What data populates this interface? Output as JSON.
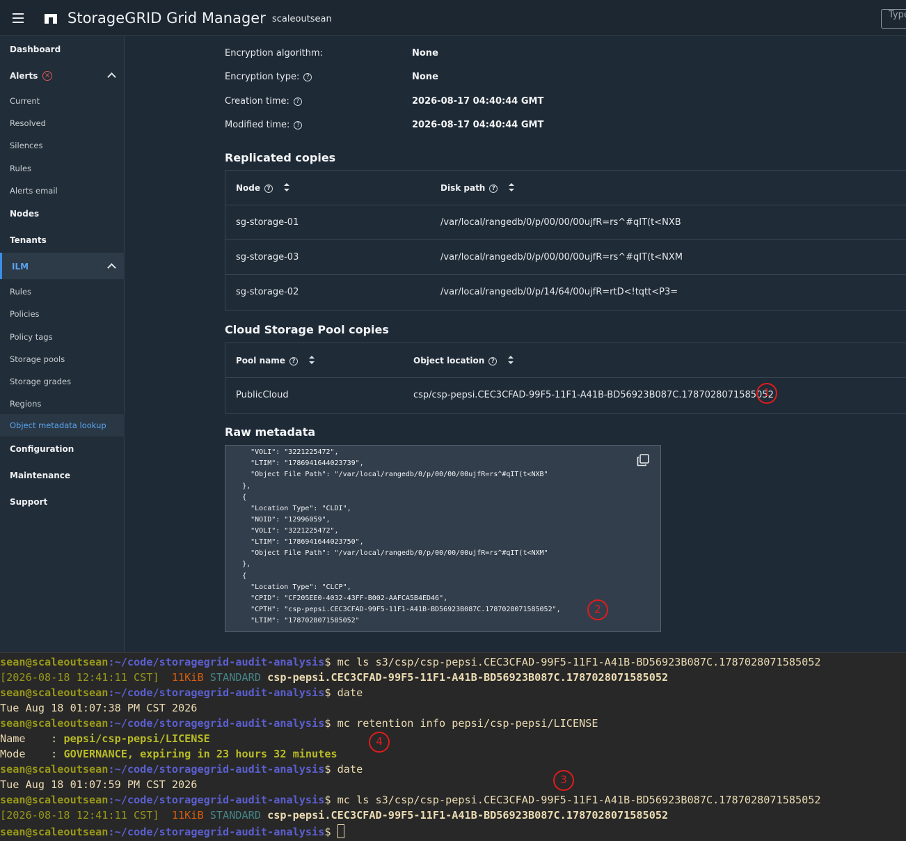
{
  "header": {
    "app_title": "StorageGRID Grid Manager",
    "grid_name": "scaleoutsean",
    "search_placeholder": "Type"
  },
  "sidebar": {
    "dashboard": "Dashboard",
    "alerts": "Alerts",
    "alerts_sub": [
      "Current",
      "Resolved",
      "Silences",
      "Rules",
      "Alerts email"
    ],
    "nodes": "Nodes",
    "tenants": "Tenants",
    "ilm": "ILM",
    "ilm_sub": [
      "Rules",
      "Policies",
      "Policy tags",
      "Storage pools",
      "Storage grades",
      "Regions",
      "Object metadata lookup"
    ],
    "configuration": "Configuration",
    "maintenance": "Maintenance",
    "support": "Support"
  },
  "object_info": {
    "encryption_algorithm_label": "Encryption algorithm:",
    "encryption_algorithm_value": "None",
    "encryption_type_label": "Encryption type:",
    "encryption_type_value": "None",
    "creation_time_label": "Creation time:",
    "creation_time_value": "2026-08-17 04:40:44 GMT",
    "modified_time_label": "Modified time:",
    "modified_time_value": "2026-08-17 04:40:44 GMT"
  },
  "replicated": {
    "title": "Replicated copies",
    "col_node": "Node",
    "col_disk_path": "Disk path",
    "rows": [
      {
        "node": "sg-storage-01",
        "path": "/var/local/rangedb/0/p/00/00/00ujfR=rs^#qIT(t<NXB"
      },
      {
        "node": "sg-storage-03",
        "path": "/var/local/rangedb/0/p/00/00/00ujfR=rs^#qIT(t<NXM"
      },
      {
        "node": "sg-storage-02",
        "path": "/var/local/rangedb/0/p/14/64/00ujfR=rtD<!tqtt<P3="
      }
    ]
  },
  "cloud": {
    "title": "Cloud Storage Pool copies",
    "col_pool": "Pool name",
    "col_location": "Object location",
    "rows": [
      {
        "pool": "PublicCloud",
        "location": "csp/csp-pepsi.CEC3CFAD-99F5-11F1-A41B-BD56923B087C.1787028071585052"
      }
    ]
  },
  "raw": {
    "title": "Raw metadata",
    "lines": [
      "      \"VOLI\": \"3221225472\",",
      "      \"LTIM\": \"1786941644023739\",",
      "      \"Object File Path\": \"/var/local/rangedb/0/p/00/00/00ujfR=rs^#qIT(t<NXB\"",
      "    },",
      "    {",
      "      \"Location Type\": \"CLDI\",",
      "      \"NOID\": \"12996059\",",
      "      \"VOLI\": \"3221225472\",",
      "      \"LTIM\": \"1786941644023750\",",
      "      \"Object File Path\": \"/var/local/rangedb/0/p/00/00/00ujfR=rs^#qIT(t<NXM\"",
      "    },",
      "    {",
      "      \"Location Type\": \"CLCP\",",
      "      \"CPID\": \"CF205EE0-4032-43FF-B002-AAFCA5B4ED46\",",
      "      \"CPTH\": \"csp-pepsi.CEC3CFAD-99F5-11F1-A41B-BD56923B087C.1787028071585052\",",
      "      \"LTIM\": \"1787028071585052\""
    ]
  },
  "annotations": [
    "1",
    "2",
    "3",
    "4"
  ],
  "terminal": {
    "user": "sean@scaleoutsean",
    "path": ":~/code/storagegrid-audit-analysis",
    "prompt_end": "$ ",
    "cmd1": "mc ls s3/csp/csp-pepsi.CEC3CFAD-99F5-11F1-A41B-BD56923B087C.1787028071585052",
    "ls_date": "[2026-08-18 12:41:11 CST]",
    "ls_size": "  11KiB",
    "ls_class": "STANDARD",
    "ls_name": "csp-pepsi.CEC3CFAD-99F5-11F1-A41B-BD56923B087C.1787028071585052",
    "cmd_date": "date",
    "date1": "Tue Aug 18 01:07:38 PM CST 2026",
    "cmd_retention": "mc retention info pepsi/csp-pepsi/LICENSE",
    "name_label": "Name    : ",
    "name_value": "pepsi/csp-pepsi/LICENSE",
    "mode_label": "Mode    : ",
    "mode_value": "GOVERNANCE, expiring in 23 hours 32 minutes",
    "date2": "Tue Aug 18 01:07:59 PM CST 2026"
  },
  "colors": {
    "accent": "#5aa5f0",
    "annotation_red": "#e01c1c",
    "terminal_bg": "#282828"
  }
}
